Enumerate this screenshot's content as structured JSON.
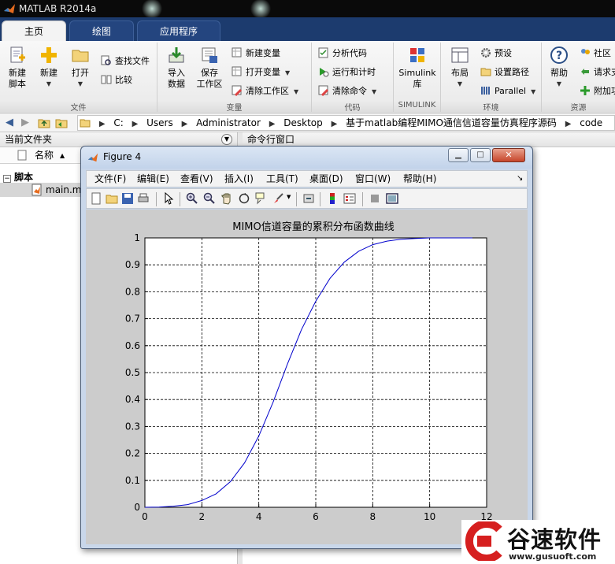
{
  "app": {
    "title": "MATLAB R2014a"
  },
  "tabs": [
    {
      "label": "主页",
      "active": true
    },
    {
      "label": "绘图",
      "active": false
    },
    {
      "label": "应用程序",
      "active": false
    }
  ],
  "ribbon": {
    "file": {
      "section_label": "文件",
      "new_script": "新建\n脚本",
      "new": "新建",
      "open": "打开",
      "find_files": "查找文件",
      "compare": "比较"
    },
    "variable": {
      "section_label": "变量",
      "import": "导入\n数据",
      "save_ws": "保存\n工作区",
      "new_var": "新建变量",
      "open_var": "打开变量",
      "clear_ws": "清除工作区"
    },
    "code": {
      "section_label": "代码",
      "analyze": "分析代码",
      "run_time": "运行和计时",
      "clear_cmd": "清除命令"
    },
    "simulink": {
      "section_label": "SIMULINK",
      "lib": "Simulink\n库"
    },
    "env": {
      "section_label": "环境",
      "layout": "布局",
      "prefs": "预设",
      "set_path": "设置路径",
      "parallel": "Parallel"
    },
    "resources": {
      "section_label": "资源",
      "help": "帮助",
      "community": "社区",
      "request": "请求支",
      "addons": "附加功"
    }
  },
  "address": {
    "crumbs": [
      "C:",
      "Users",
      "Administrator",
      "Desktop",
      "基于matlab编程MIMO通信信道容量仿真程序源码",
      "code"
    ]
  },
  "left_panel": {
    "title": "当前文件夹",
    "col_name": "名称",
    "sort": "▲",
    "group": "脚本",
    "file": "main.m"
  },
  "cmd_window": {
    "title": "命令行窗口"
  },
  "figure": {
    "window_title": "Figure 4",
    "menu": [
      "文件(F)",
      "编辑(E)",
      "查看(V)",
      "插入(I)",
      "工具(T)",
      "桌面(D)",
      "窗口(W)",
      "帮助(H)"
    ],
    "toolbar_icons": [
      "new-figure-icon",
      "open-icon",
      "save-icon",
      "print-icon",
      "pointer-icon",
      "zoom-in-icon",
      "zoom-out-icon",
      "pan-icon",
      "rotate-icon",
      "data-cursor-icon",
      "brush-icon",
      "link-icon",
      "colorbar-icon",
      "legend-icon",
      "hide-tools-icon",
      "show-tools-icon"
    ]
  },
  "chart_data": {
    "type": "line",
    "title": "MIMO信道容量的累积分布函数曲线",
    "xlabel": "",
    "ylabel": "",
    "xlim": [
      0,
      12
    ],
    "ylim": [
      0,
      1
    ],
    "xticks": [
      0,
      2,
      4,
      6,
      8,
      10,
      12
    ],
    "yticks": [
      0,
      0.1,
      0.2,
      0.3,
      0.4,
      0.5,
      0.6,
      0.7,
      0.8,
      0.9,
      1
    ],
    "grid": true,
    "line_color": "#0000cc",
    "series": [
      {
        "x": [
          0,
          0.5,
          1,
          1.5,
          2,
          2.5,
          3,
          3.5,
          4,
          4.5,
          5,
          5.5,
          6,
          6.5,
          7,
          7.5,
          8,
          8.5,
          9,
          9.5,
          10,
          10.5,
          11,
          11.5
        ],
        "values": [
          0,
          0.001,
          0.004,
          0.01,
          0.025,
          0.05,
          0.095,
          0.165,
          0.265,
          0.39,
          0.53,
          0.66,
          0.765,
          0.85,
          0.91,
          0.95,
          0.975,
          0.988,
          0.995,
          0.998,
          1,
          1,
          1,
          1
        ]
      }
    ]
  },
  "watermark": {
    "text": "谷速软件",
    "url": "www.gusuoft.com"
  }
}
